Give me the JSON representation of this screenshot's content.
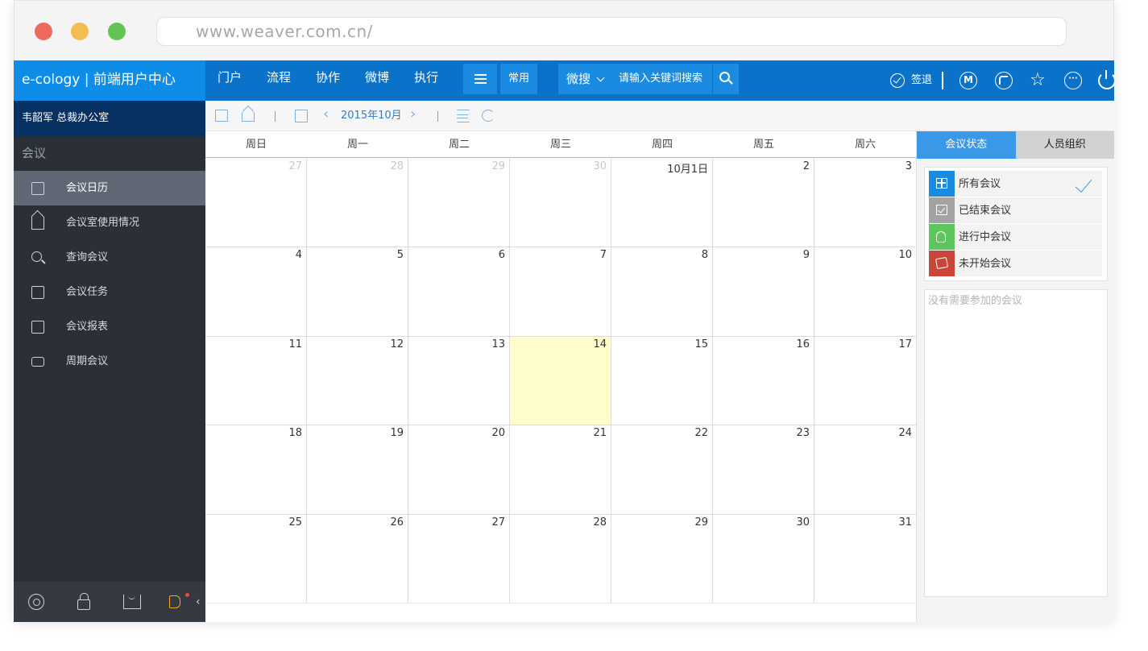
{
  "browser": {
    "url": "www.weaver.com.cn/"
  },
  "topbar": {
    "brand": "e-cology | 前端用户中心",
    "nav": [
      "门户",
      "流程",
      "协作",
      "微博",
      "执行"
    ],
    "common_label": "常用",
    "search_type": "微搜",
    "search_placeholder": "请输入关键词搜索",
    "signout_label": "签退",
    "m_label": "M",
    "more_label": "···",
    "icons": [
      "menu-icon",
      "chevron-down-icon",
      "search-icon",
      "check-circle-icon",
      "m-circle-icon",
      "globe-icon",
      "star-icon",
      "more-icon",
      "power-icon"
    ]
  },
  "sidebar": {
    "user": "韦韶军  总裁办公室",
    "section_title": "会议",
    "items": [
      {
        "label": "会议日历",
        "icon": "calendar-icon",
        "active": true
      },
      {
        "label": "会议室使用情况",
        "icon": "room-icon",
        "active": false
      },
      {
        "label": "查询会议",
        "icon": "search-icon",
        "active": false
      },
      {
        "label": "会议任务",
        "icon": "task-icon",
        "active": false
      },
      {
        "label": "会议报表",
        "icon": "report-icon",
        "active": false
      },
      {
        "label": "周期会议",
        "icon": "cycle-icon",
        "active": false
      }
    ],
    "footer_icons": [
      "settings-icon",
      "lock-icon",
      "shirt-icon",
      "speaker-icon"
    ],
    "collapse_label": "‹"
  },
  "toolbar": {
    "month": "2015年10月",
    "prev_label": "‹",
    "next_label": "›",
    "icons": [
      "new-folder-icon",
      "home-icon",
      "calendar-view-icon",
      "chevron-left-icon",
      "chevron-right-icon",
      "list-view-icon",
      "refresh-icon"
    ]
  },
  "calendar": {
    "weekdays": [
      "周日",
      "周一",
      "周二",
      "周三",
      "周四",
      "周五",
      "周六"
    ],
    "weeks": [
      [
        {
          "d": "27",
          "other": true
        },
        {
          "d": "28",
          "other": true
        },
        {
          "d": "29",
          "other": true
        },
        {
          "d": "30",
          "other": true
        },
        {
          "d": "10月1日"
        },
        {
          "d": "2"
        },
        {
          "d": "3"
        }
      ],
      [
        {
          "d": "4"
        },
        {
          "d": "5"
        },
        {
          "d": "6"
        },
        {
          "d": "7"
        },
        {
          "d": "8"
        },
        {
          "d": "9"
        },
        {
          "d": "10"
        }
      ],
      [
        {
          "d": "11"
        },
        {
          "d": "12"
        },
        {
          "d": "13"
        },
        {
          "d": "14",
          "today": true
        },
        {
          "d": "15"
        },
        {
          "d": "16"
        },
        {
          "d": "17"
        }
      ],
      [
        {
          "d": "18"
        },
        {
          "d": "19"
        },
        {
          "d": "20"
        },
        {
          "d": "21"
        },
        {
          "d": "22"
        },
        {
          "d": "23"
        },
        {
          "d": "24"
        }
      ],
      [
        {
          "d": "25"
        },
        {
          "d": "26"
        },
        {
          "d": "27"
        },
        {
          "d": "28"
        },
        {
          "d": "29"
        },
        {
          "d": "30"
        },
        {
          "d": "31"
        }
      ]
    ],
    "today_color": "#fefccb"
  },
  "right_panel": {
    "tabs": [
      "会议状态",
      "人员组织"
    ],
    "statuses": [
      {
        "label": "所有会议",
        "color": "#1a8be0",
        "icon": "grid-icon",
        "checked": true
      },
      {
        "label": "已结束会议",
        "color": "#a3a3a3",
        "icon": "checkbox-icon",
        "checked": false
      },
      {
        "label": "进行中会议",
        "color": "#5cc65d",
        "icon": "hand-icon",
        "checked": false
      },
      {
        "label": "未开始会议",
        "color": "#c9463b",
        "icon": "tag-icon",
        "checked": false
      }
    ],
    "empty_text": "没有需要参加的会议"
  }
}
